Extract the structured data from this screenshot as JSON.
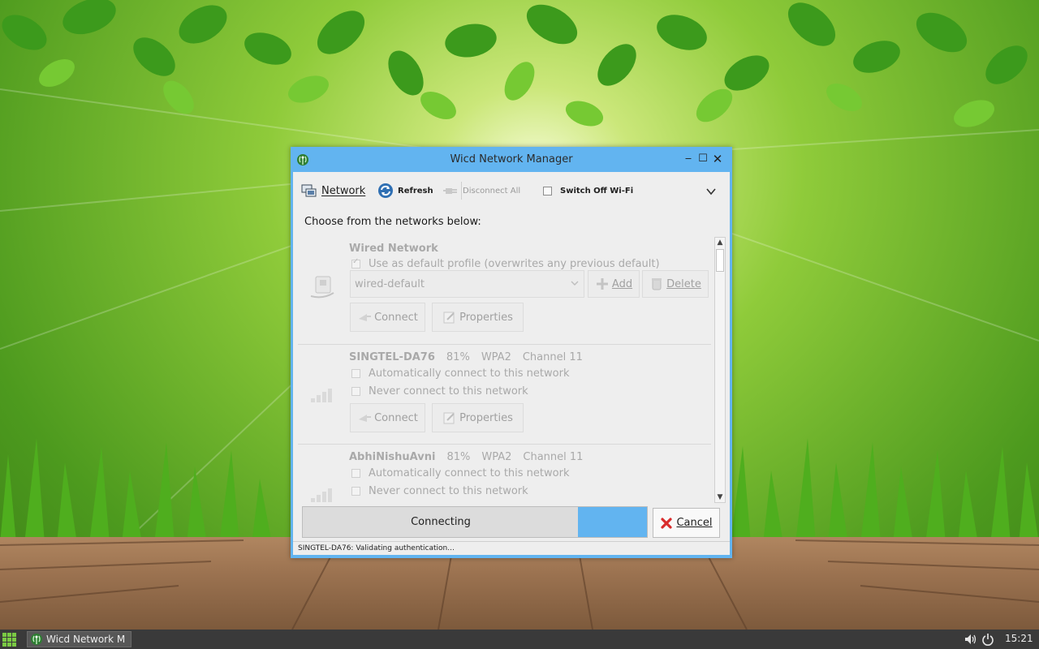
{
  "window": {
    "title": "Wicd Network Manager",
    "controls": {
      "minimize": "‒",
      "maximize": "☐",
      "close": "✕"
    }
  },
  "toolbar": {
    "network_label": "Network",
    "refresh_label": "Refresh",
    "disconnect_label": "Disconnect All",
    "switch_wifi_label": "Switch Off Wi-Fi",
    "switch_wifi_checked": false
  },
  "main": {
    "prompt": "Choose from the networks below:"
  },
  "wired": {
    "title": "Wired Network",
    "default_profile_label": "Use as default profile (overwrites any previous default)",
    "default_profile_checked": true,
    "profile_value": "wired-default",
    "add_label": "Add",
    "delete_label": "Delete",
    "connect_label": "Connect",
    "properties_label": "Properties"
  },
  "networks": [
    {
      "ssid": "SINGTEL-DA76",
      "strength": "81%",
      "encryption": "WPA2",
      "channel": "Channel 11",
      "auto_connect_label": "Automatically connect to this network",
      "never_connect_label": "Never connect to this network",
      "connect_label": "Connect",
      "properties_label": "Properties"
    },
    {
      "ssid": "AbhiNishuAvni",
      "strength": "81%",
      "encryption": "WPA2",
      "channel": "Channel 11",
      "auto_connect_label": "Automatically connect to this network",
      "never_connect_label": "Never connect to this network"
    }
  ],
  "progress": {
    "label": "Connecting",
    "indicator_start_fraction": 0.8,
    "indicator_width_fraction": 0.2
  },
  "cancel_label": "Cancel",
  "statusbar": {
    "text": "SINGTEL-DA76: Validating authentication..."
  },
  "taskbar": {
    "task_label": "Wicd Network M",
    "clock": "15:21"
  },
  "colors": {
    "accent": "#62b4f0",
    "window_bg": "#eeeeee",
    "taskbar": "#3a3a3a",
    "cancel_red": "#d92b2b"
  },
  "icons": {
    "app": "wicd-antenna-icon",
    "network": "network-computers-icon",
    "refresh": "refresh-icon",
    "disconnect": "unplug-icon",
    "wired": "wired-network-icon",
    "wireless": "signal-bars-icon",
    "add": "plus-icon",
    "delete": "trash-icon",
    "connect": "connect-icon",
    "properties": "edit-icon",
    "cancel": "red-x-icon",
    "volume": "volume-icon",
    "power": "power-icon",
    "menu": "app-grid-icon"
  }
}
